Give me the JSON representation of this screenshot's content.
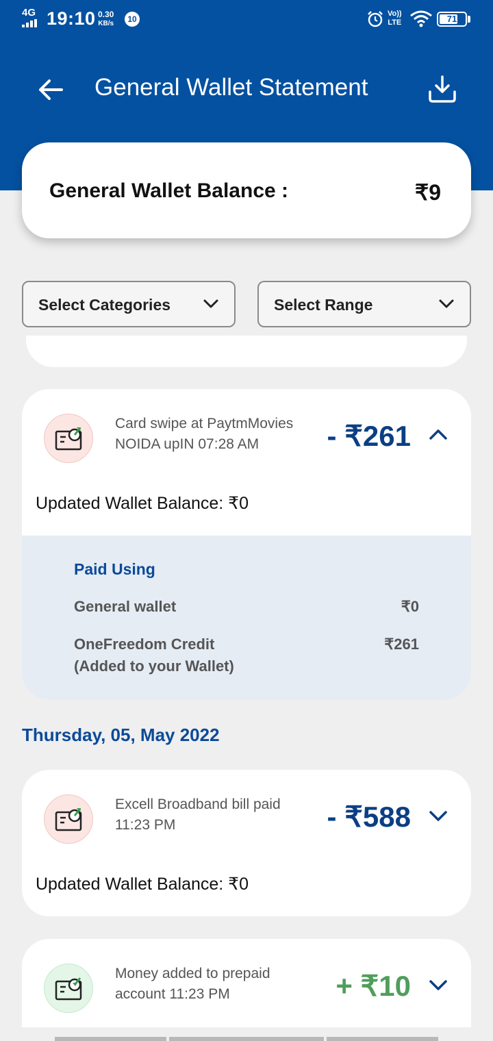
{
  "status_bar": {
    "network": "4G",
    "time": "19:10",
    "speed_value": "0.30",
    "speed_unit": "KB/s",
    "notification_count": "10",
    "volte_top": "Vo))",
    "volte_bottom": "LTE",
    "battery": "71",
    "battery_level": 0.71
  },
  "header": {
    "title": "General Wallet Statement",
    "back_icon": "arrow-left-icon",
    "download_icon": "download-icon"
  },
  "balance_card": {
    "label": "General Wallet Balance :",
    "value": "₹9"
  },
  "filters": {
    "categories_label": "Select Categories",
    "range_label": "Select Range"
  },
  "transactions": [
    {
      "desc_line1": "Card swipe at PaytmMovies",
      "desc_line2": "NOIDA upIN 07:28 AM",
      "amount": "- ₹261",
      "type": "debit",
      "expanded": true,
      "updated_balance": "Updated Wallet Balance: ₹0",
      "paid_using": {
        "title": "Paid Using",
        "rows": [
          {
            "label": "General wallet",
            "label2": "",
            "value": "₹0"
          },
          {
            "label": "OneFreedom Credit",
            "label2": "(Added to your Wallet)",
            "value": "₹261"
          }
        ]
      }
    },
    {
      "desc_line1": "Excell Broadband bill paid",
      "desc_line2": "11:23 PM",
      "amount": "- ₹588",
      "type": "debit",
      "expanded": false,
      "updated_balance": "Updated Wallet Balance: ₹0"
    },
    {
      "desc_line1": "Money added to prepaid",
      "desc_line2": "account 11:23 PM",
      "amount": "+ ₹10",
      "type": "credit",
      "expanded": false
    }
  ],
  "date_header": "Thursday, 05, May 2022",
  "colors": {
    "primary": "#0451a1",
    "debit": "#0b3f84",
    "credit": "#4f9e5b",
    "panel": "#e5ecf4"
  }
}
